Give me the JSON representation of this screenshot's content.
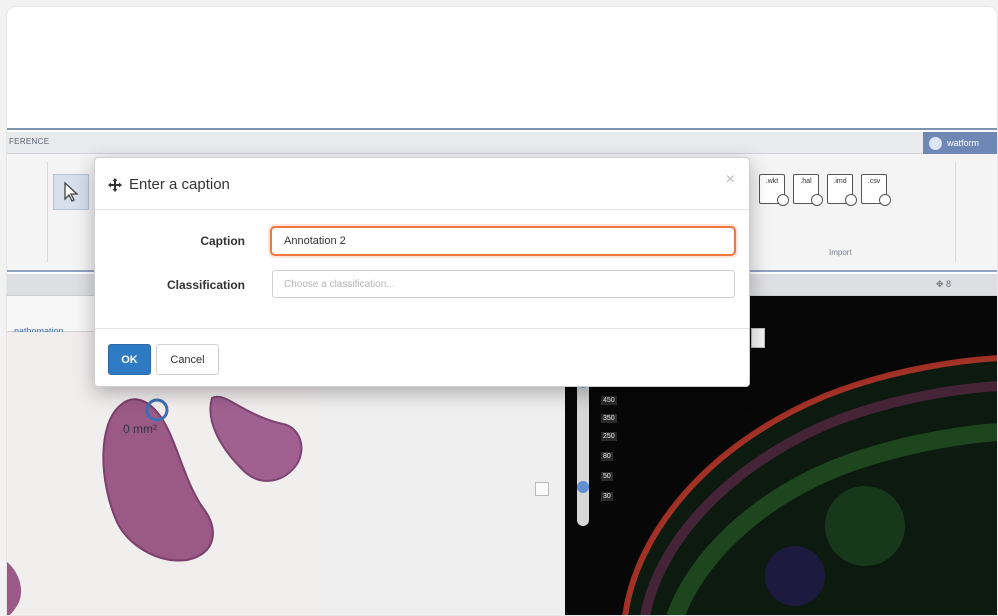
{
  "app": {
    "toolbar_tab": "FERENCE",
    "user_chip": "watform",
    "import_group_label": "Import",
    "import_icons": [
      ".wkt",
      ".hal",
      ".imd",
      ".csv"
    ],
    "panel_count": "8",
    "left_panel_link": "_pathomation_",
    "area_label": "0 mm²",
    "scale_labels": [
      "450",
      "350",
      "250",
      "80",
      "50",
      "30"
    ]
  },
  "dialog": {
    "title": "Enter a caption",
    "close_label": "×",
    "caption_label": "Caption",
    "caption_value": "Annotation 2",
    "classification_label": "Classification",
    "classification_placeholder": "Choose a classification...",
    "ok_label": "OK",
    "cancel_label": "Cancel"
  },
  "colors": {
    "primary_button": "#2e7bc4",
    "focus_ring": "#f0773f",
    "user_chip": "#6e87b4"
  },
  "icons": {
    "move": "move-arrows-icon",
    "pointer": "cursor-arrow-icon",
    "user": "user-icon"
  }
}
